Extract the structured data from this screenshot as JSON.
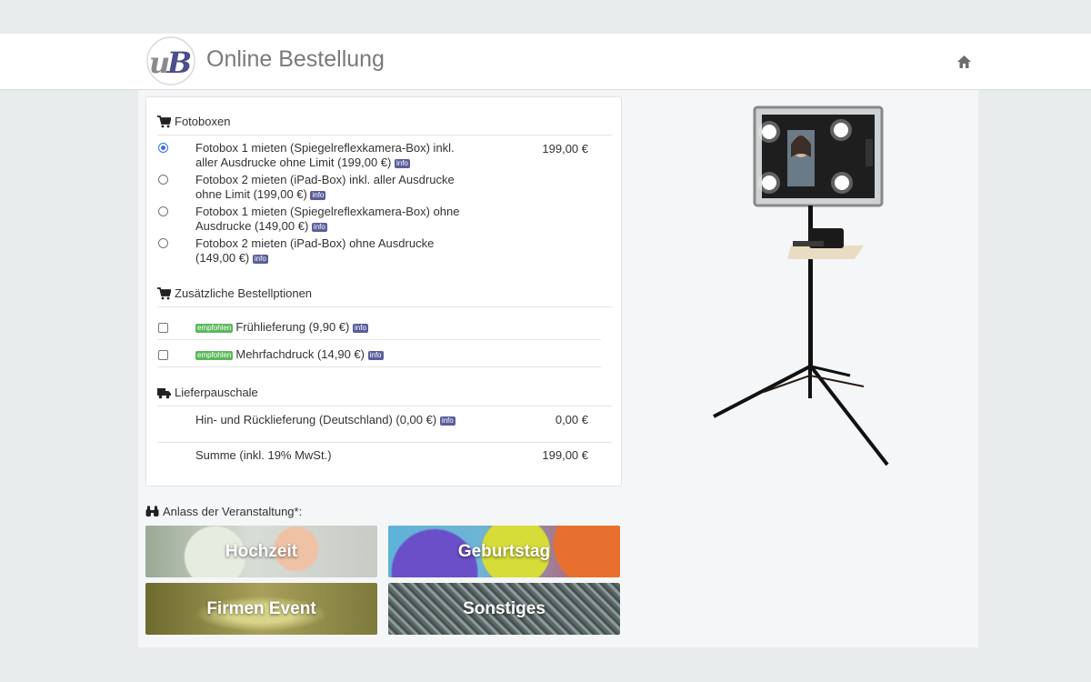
{
  "header": {
    "title": "Online Bestellung",
    "logo_text": "UB"
  },
  "fotoboxen": {
    "heading": "Fotoboxen",
    "price_selected": "199,00 €",
    "options": [
      {
        "line1": "Fotobox 1 mieten (Spiegelreflexkamera-Box) inkl.",
        "line2": "aller Ausdrucke ohne Limit (199,00 €)",
        "checked": true
      },
      {
        "line1": "Fotobox 2 mieten (iPad-Box) inkl. aller Ausdrucke",
        "line2": "ohne Limit (199,00 €)",
        "checked": false
      },
      {
        "line1": "Fotobox 1 mieten (Spiegelreflexkamera-Box) ohne",
        "line2": "Ausdrucke (149,00 €)",
        "checked": false
      },
      {
        "line1": "Fotobox 2 mieten (iPad-Box) ohne Ausdrucke",
        "line2": "(149,00 €)",
        "checked": false
      }
    ]
  },
  "zusatz": {
    "heading": "Zusätzliche Bestellptionen",
    "badge": "empfohlen",
    "options": [
      {
        "label": "Frühlieferung (9,90 €)"
      },
      {
        "label": "Mehrfachdruck (14,90 €)"
      }
    ]
  },
  "liefer": {
    "heading": "Lieferpauschale",
    "label": "Hin- und Rücklieferung (Deutschland) (0,00 €)",
    "price": "0,00 €"
  },
  "summe": {
    "label": "Summe (inkl. 19% MwSt.)",
    "price": "199,00 €"
  },
  "info_label": "info",
  "anlass": {
    "heading": "Anlass der Veranstaltung*:",
    "tiles": [
      "Hochzeit",
      "Geburtstag",
      "Firmen Event",
      "Sonstiges"
    ]
  },
  "icons": {
    "home": "home-icon",
    "cart": "cart-icon",
    "truck": "truck-icon",
    "binoculars": "binoculars-icon"
  }
}
